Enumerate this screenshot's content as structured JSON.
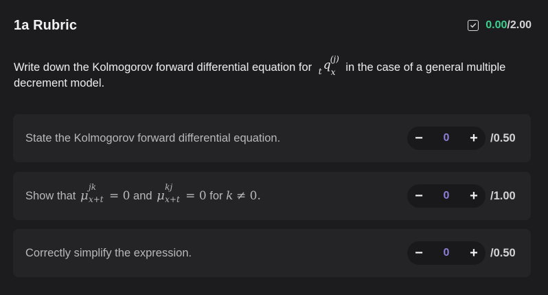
{
  "header": {
    "title": "1a Rubric",
    "score_earned": "0.00",
    "score_separator": "/",
    "score_total": "2.00",
    "score_icon": "checkbox-check-icon"
  },
  "question": {
    "text_before": "Write down the Kolmogorov forward differential equation for",
    "math_prefix": "t",
    "math_symbol": "q",
    "math_sup": "(j)",
    "math_sub": "x",
    "text_after": "in the case of a general multiple decrement model."
  },
  "criteria": [
    {
      "label": "State the Kolmogorov forward differential equation.",
      "value": "0",
      "max": "/0.50",
      "minus_label": "−",
      "plus_label": "+"
    },
    {
      "label_parts": {
        "prefix": "Show that",
        "mu1_sup": "jk",
        "mu1_sub": "x+t",
        "eq1": "= 0",
        "and": "and",
        "mu2_sup": "kj",
        "mu2_sub": "x+t",
        "eq2": "= 0",
        "for": "for",
        "cond_var": "k",
        "cond_rel": "≠ 0."
      },
      "value": "0",
      "max": "/1.00",
      "minus_label": "−",
      "plus_label": "+"
    },
    {
      "label": "Correctly simplify the expression.",
      "value": "0",
      "max": "/0.50",
      "minus_label": "−",
      "plus_label": "+"
    }
  ],
  "colors": {
    "background": "#1c1c1e",
    "card": "#242426",
    "stepper": "#19191b",
    "earned": "#3ecf8e",
    "stepper_value": "#8d7fd8"
  }
}
